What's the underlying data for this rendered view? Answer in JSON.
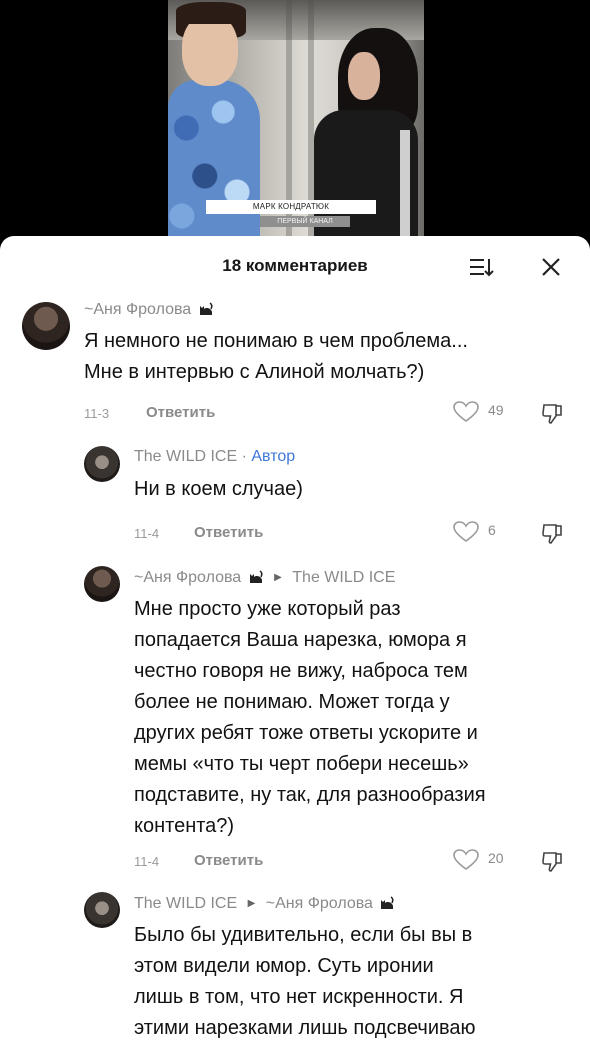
{
  "video": {
    "caption": "МАРК КОНДРАТЮК",
    "subcaption": "ПЕРВЫЙ КАНАЛ"
  },
  "sheet": {
    "title": "18 комментариев",
    "icons": {
      "sort": "sort-filter-icon",
      "close": "close-icon"
    }
  },
  "comments": [
    {
      "author": "~Аня Фролова",
      "text": "Я немного не понимаю в чем проблема...\nМне в интервью с Алиной молчать?)",
      "date": "11-3",
      "reply": "Ответить",
      "likes": "49"
    },
    {
      "author": "The WILD ICE",
      "tag": "Автор",
      "text": "Ни в коем случае)",
      "date": "11-4",
      "reply": "Ответить",
      "likes": "6"
    },
    {
      "author": "~Аня Фролова",
      "reply_to": "The WILD ICE",
      "text": "Мне просто уже который раз\nпопадается Ваша нарезка, юмора я\nчестно говоря не вижу, наброса тем\nболее не понимаю. Может тогда у\nдругих ребят тоже ответы ускорите и\nмемы «что ты черт побери несешь»\nподставите, ну так, для разнообразия\nконтента?)",
      "date": "11-4",
      "reply": "Ответить",
      "likes": "20"
    },
    {
      "author": "The WILD ICE",
      "reply_to": "~Аня Фролова",
      "text": "Было бы удивительно, если бы вы в\nэтом видели юмор. Суть иронии\nлишь в том, что нет искренности. Я\nэтими нарезками лишь подсвечиваю"
    }
  ],
  "colors": {
    "accent_author": "#3f78d8",
    "meta": "#8a8a8a"
  }
}
